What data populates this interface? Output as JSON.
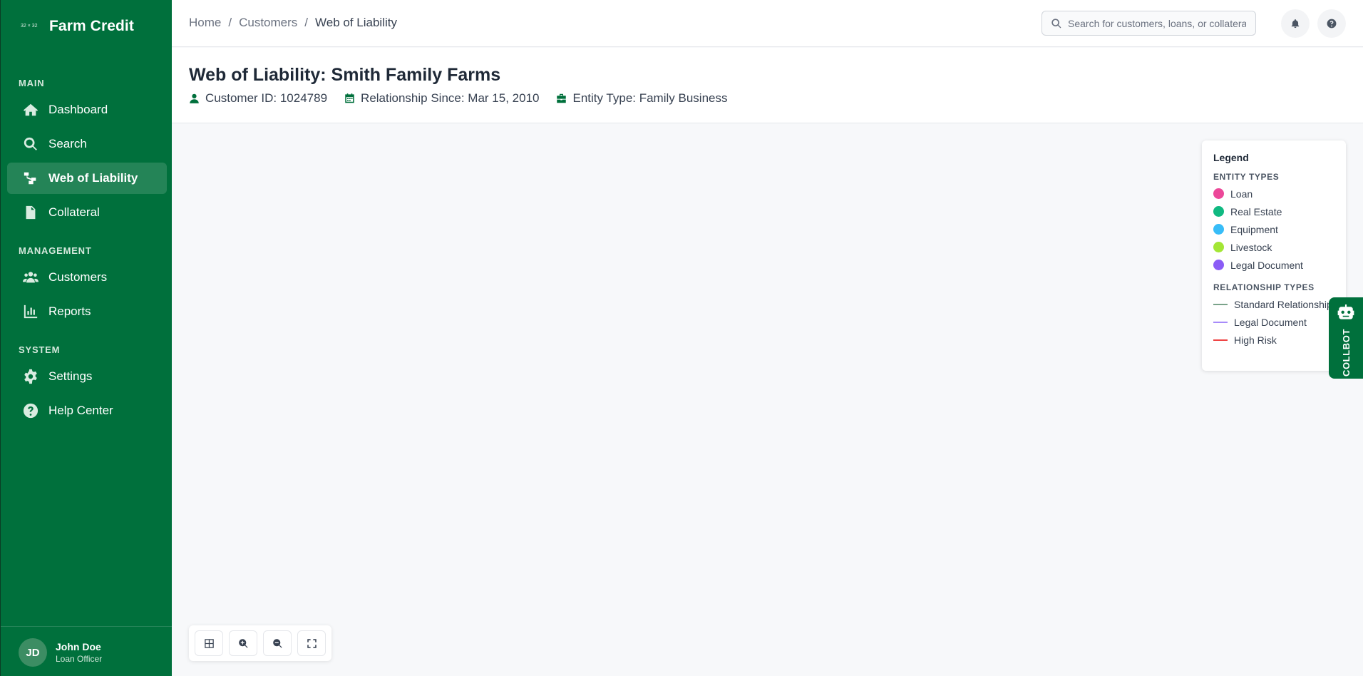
{
  "brand": {
    "logo_text": "32 × 32",
    "name": "Farm Credit"
  },
  "sidebar": {
    "sections": [
      {
        "title": "MAIN"
      },
      {
        "title": "MANAGEMENT"
      },
      {
        "title": "SYSTEM"
      }
    ],
    "items": [
      {
        "label": "Dashboard",
        "icon": "home-icon"
      },
      {
        "label": "Search",
        "icon": "search-icon"
      },
      {
        "label": "Web of Liability",
        "icon": "network-icon",
        "active": true
      },
      {
        "label": "Collateral",
        "icon": "document-icon"
      },
      {
        "label": "Customers",
        "icon": "users-icon"
      },
      {
        "label": "Reports",
        "icon": "chart-icon"
      },
      {
        "label": "Settings",
        "icon": "gear-icon"
      },
      {
        "label": "Help Center",
        "icon": "help-icon"
      }
    ]
  },
  "user": {
    "initials": "JD",
    "name": "John Doe",
    "role": "Loan Officer"
  },
  "breadcrumb": {
    "items": [
      "Home",
      "Customers",
      "Web of Liability"
    ],
    "separator": "/"
  },
  "search": {
    "placeholder": "Search for customers, loans, or collateral..."
  },
  "header": {
    "title": "Web of Liability: Smith Family Farms",
    "customer_id": "Customer ID: 1024789",
    "relationship_since": "Relationship Since: Mar 15, 2010",
    "entity_type": "Entity Type: Family Business"
  },
  "legend": {
    "title": "Legend",
    "entity_types_title": "ENTITY TYPES",
    "entity_types": [
      {
        "label": "Loan",
        "color": "#ec4899"
      },
      {
        "label": "Real Estate",
        "color": "#10b981"
      },
      {
        "label": "Equipment",
        "color": "#38bdf8"
      },
      {
        "label": "Livestock",
        "color": "#a3e635"
      },
      {
        "label": "Legal Document",
        "color": "#8b5cf6"
      }
    ],
    "relationship_types_title": "RELATIONSHIP TYPES",
    "relationship_types": [
      {
        "label": "Standard Relationship",
        "color": "#7aa38a"
      },
      {
        "label": "Legal Document",
        "color": "#a78bfa"
      },
      {
        "label": "High Risk",
        "color": "#ef4444"
      }
    ]
  },
  "collbot": {
    "label": "COLLBOT"
  },
  "colors": {
    "brand": "#00703c",
    "page_bg": "#f7f8fa"
  }
}
